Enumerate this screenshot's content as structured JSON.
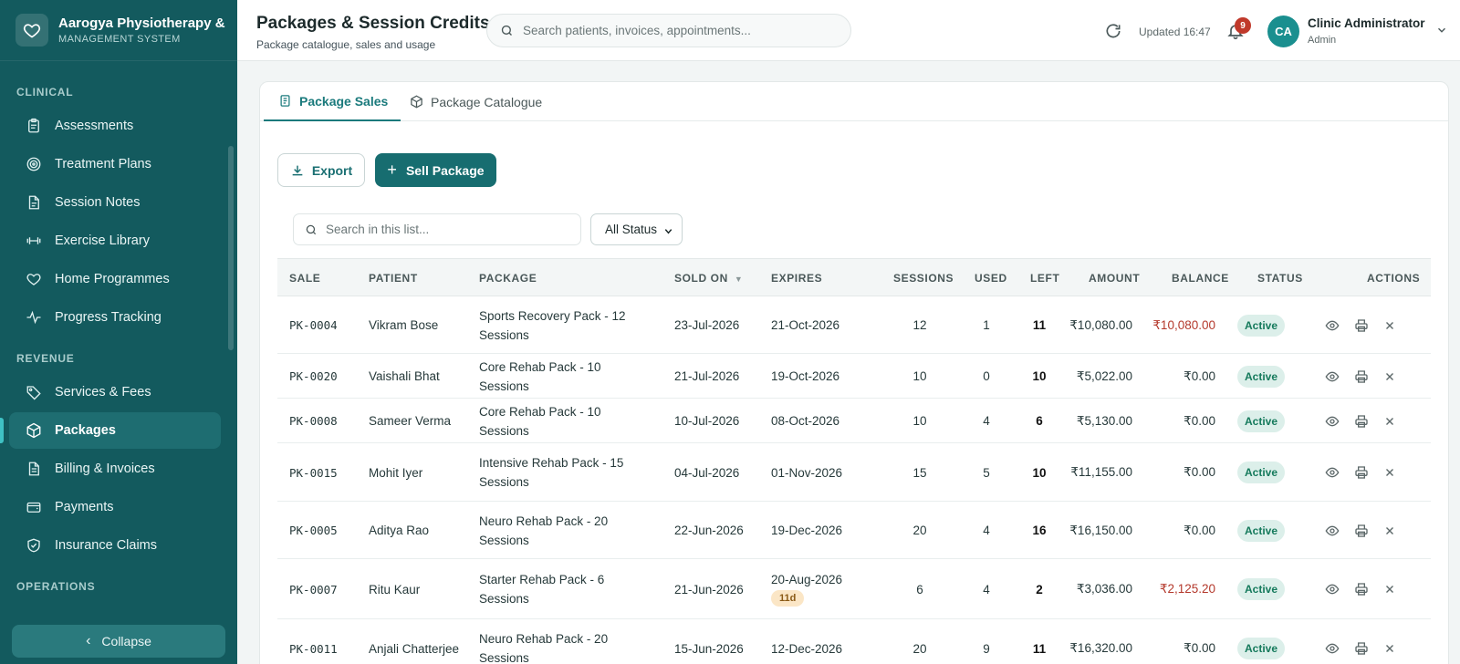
{
  "sidebar": {
    "brand_title": "Aarogya Physiotherapy & I",
    "brand_subtitle": "MANAGEMENT SYSTEM",
    "sections": {
      "clinical": "CLINICAL",
      "revenue": "REVENUE",
      "operations": "OPERATIONS"
    },
    "items": {
      "assessments": "Assessments",
      "treatment_plans": "Treatment Plans",
      "session_notes": "Session Notes",
      "exercise_library": "Exercise Library",
      "home_programmes": "Home Programmes",
      "progress_tracking": "Progress Tracking",
      "services_fees": "Services & Fees",
      "packages": "Packages",
      "billing_invoices": "Billing & Invoices",
      "payments": "Payments",
      "insurance_claims": "Insurance Claims"
    },
    "collapse_label": "Collapse"
  },
  "header": {
    "title": "Packages & Session Credits",
    "subtitle": "Package catalogue, sales and usage",
    "search_placeholder": "Search patients, invoices, appointments...",
    "updated": "Updated 16:47",
    "notifications": "9",
    "avatar_initials": "CA",
    "user_name": "Clinic Administrator",
    "user_role": "Admin"
  },
  "tabs": {
    "sales": "Package Sales",
    "catalogue": "Package Catalogue"
  },
  "toolbar": {
    "export_label": "Export",
    "sell_label": "Sell Package",
    "list_search_placeholder": "Search in this list...",
    "status_filter": "All Status"
  },
  "table": {
    "headers": {
      "sale": "SALE",
      "patient": "PATIENT",
      "package": "PACKAGE",
      "sold_on": "SOLD ON",
      "sort_indicator": "▼",
      "expires": "EXPIRES",
      "sessions": "SESSIONS",
      "used": "USED",
      "left": "LEFT",
      "amount": "AMOUNT",
      "balance": "BALANCE",
      "status": "STATUS",
      "actions": "ACTIONS"
    },
    "rows": [
      {
        "sale": "PK-0004",
        "patient": "Vikram Bose",
        "package": "Sports Recovery Pack - 12 Sessions",
        "sold_on": "23-Jul-2026",
        "expires": "21-Oct-2026",
        "expiry_badge": "",
        "sessions": "12",
        "used": "1",
        "left": "11",
        "amount": "₹10,080.00",
        "balance": "₹10,080.00",
        "balance_due": true,
        "status": "Active"
      },
      {
        "sale": "PK-0020",
        "patient": "Vaishali Bhat",
        "package": "Core Rehab Pack - 10 Sessions",
        "sold_on": "21-Jul-2026",
        "expires": "19-Oct-2026",
        "expiry_badge": "",
        "sessions": "10",
        "used": "0",
        "left": "10",
        "amount": "₹5,022.00",
        "balance": "₹0.00",
        "balance_due": false,
        "status": "Active"
      },
      {
        "sale": "PK-0008",
        "patient": "Sameer Verma",
        "package": "Core Rehab Pack - 10 Sessions",
        "sold_on": "10-Jul-2026",
        "expires": "08-Oct-2026",
        "expiry_badge": "",
        "sessions": "10",
        "used": "4",
        "left": "6",
        "amount": "₹5,130.00",
        "balance": "₹0.00",
        "balance_due": false,
        "status": "Active"
      },
      {
        "sale": "PK-0015",
        "patient": "Mohit Iyer",
        "package": "Intensive Rehab Pack - 15 Sessions",
        "sold_on": "04-Jul-2026",
        "expires": "01-Nov-2026",
        "expiry_badge": "",
        "sessions": "15",
        "used": "5",
        "left": "10",
        "amount": "₹11,155.00",
        "balance": "₹0.00",
        "balance_due": false,
        "status": "Active"
      },
      {
        "sale": "PK-0005",
        "patient": "Aditya Rao",
        "package": "Neuro Rehab Pack - 20 Sessions",
        "sold_on": "22-Jun-2026",
        "expires": "19-Dec-2026",
        "expiry_badge": "",
        "sessions": "20",
        "used": "4",
        "left": "16",
        "amount": "₹16,150.00",
        "balance": "₹0.00",
        "balance_due": false,
        "status": "Active"
      },
      {
        "sale": "PK-0007",
        "patient": "Ritu Kaur",
        "package": "Starter Rehab Pack - 6 Sessions",
        "sold_on": "21-Jun-2026",
        "expires": "20-Aug-2026",
        "expiry_badge": "11d",
        "sessions": "6",
        "used": "4",
        "left": "2",
        "amount": "₹3,036.00",
        "balance": "₹2,125.20",
        "balance_due": true,
        "status": "Active"
      },
      {
        "sale": "PK-0011",
        "patient": "Anjali Chatterjee",
        "package": "Neuro Rehab Pack - 20 Sessions",
        "sold_on": "15-Jun-2026",
        "expires": "12-Dec-2026",
        "expiry_badge": "",
        "sessions": "20",
        "used": "9",
        "left": "11",
        "amount": "₹16,320.00",
        "balance": "₹0.00",
        "balance_due": false,
        "status": "Active"
      }
    ]
  },
  "colors": {
    "sidebar_bg": "#135a5e",
    "accent": "#176d70",
    "balance_due": "#b4392c",
    "status_active_bg": "#dcefea"
  }
}
